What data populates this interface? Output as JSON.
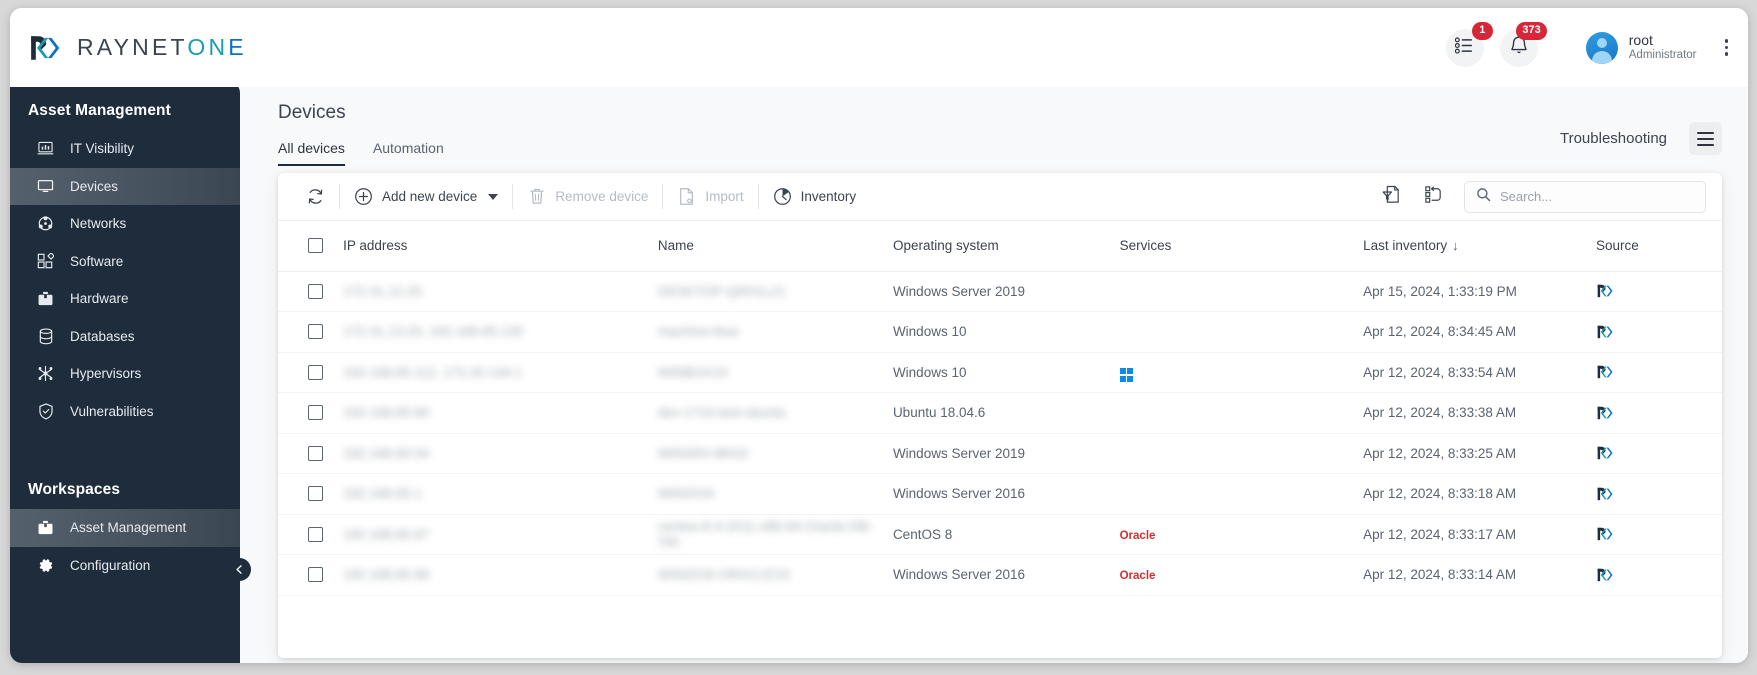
{
  "brand": {
    "name_main": "RAYNET",
    "name_accent_first": "ON",
    "name_accent_second": "E",
    "logo_icon": "raynet-logo-mark",
    "colors": {
      "dark": "#1e2c3c",
      "teal": "#1a9bb0",
      "blue": "#0b72c4"
    }
  },
  "header": {
    "tasks_icon": "task-list-icon",
    "tasks_badge": "1",
    "notifications_icon": "bell-icon",
    "notifications_badge": "373",
    "user_name": "root",
    "user_role": "Administrator",
    "avatar_icon": "user-avatar-icon",
    "overflow_icon": "vertical-dots-icon"
  },
  "sidebar": {
    "section_title": "Asset Management",
    "items": [
      {
        "label": "IT Visibility",
        "icon": "monitor-chart-icon",
        "active": false
      },
      {
        "label": "Devices",
        "icon": "desktop-icon",
        "active": true
      },
      {
        "label": "Networks",
        "icon": "network-nodes-icon",
        "active": false
      },
      {
        "label": "Software",
        "icon": "blocks-icon",
        "active": false
      },
      {
        "label": "Hardware",
        "icon": "toolbox-icon",
        "active": false
      },
      {
        "label": "Databases",
        "icon": "database-icon",
        "active": false
      },
      {
        "label": "Hypervisors",
        "icon": "hypervisor-icon",
        "active": false
      },
      {
        "label": "Vulnerabilities",
        "icon": "shield-check-icon",
        "active": false
      }
    ],
    "workspaces_title": "Workspaces",
    "workspaces": [
      {
        "label": "Asset Management",
        "icon": "briefcase-icon",
        "active": true
      },
      {
        "label": "Configuration",
        "icon": "gear-icon",
        "active": false
      }
    ],
    "collapse_icon": "chevron-left-icon"
  },
  "page": {
    "title": "Devices",
    "tabs": [
      {
        "label": "All devices",
        "active": true
      },
      {
        "label": "Automation",
        "active": false
      }
    ],
    "troubleshooting_label": "Troubleshooting",
    "menu_icon": "hamburger-menu-icon"
  },
  "toolbar": {
    "refresh_icon": "refresh-icon",
    "add_device_label": "Add new device",
    "add_device_icon": "plus-circle-icon",
    "add_device_caret": "chevron-down-icon",
    "remove_device_label": "Remove device",
    "remove_device_icon": "trash-icon",
    "remove_device_disabled": true,
    "import_label": "Import",
    "import_icon": "file-import-icon",
    "import_disabled": true,
    "inventory_label": "Inventory",
    "inventory_icon": "inventory-scan-icon",
    "filter_icon": "filter-document-icon",
    "columns_icon": "column-config-icon",
    "search_icon": "search-icon",
    "search_placeholder": "Search...",
    "search_value": ""
  },
  "table": {
    "columns": [
      "IP address",
      "Name",
      "Operating system",
      "Services",
      "Last inventory",
      "Source"
    ],
    "sorted_column": "Last inventory",
    "sort_direction": "desc",
    "sort_glyph": "↓",
    "select_all_checked": false,
    "rows": [
      {
        "checked": false,
        "ip": "172.31.12.25",
        "name": "DESKTOP-QRA1L21",
        "os": "Windows Server 2019",
        "service_icon": "",
        "service_tag": "",
        "last_inventory": "Apr 15, 2024, 1:33:19 PM",
        "source_icon": "raynet-logo-mark"
      },
      {
        "checked": false,
        "ip": "172.31.13.20, 192.168.65.130",
        "name": "machine-blue",
        "os": "Windows 10",
        "service_icon": "",
        "service_tag": "",
        "last_inventory": "Apr 12, 2024, 8:34:45 AM",
        "source_icon": "raynet-logo-mark"
      },
      {
        "checked": false,
        "ip": "192.168.65.112, 172.20.144.1",
        "name": "WINBOX10",
        "os": "Windows 10",
        "service_icon": "windows-logo-icon",
        "service_tag": "",
        "last_inventory": "Apr 12, 2024, 8:33:54 AM",
        "source_icon": "raynet-logo-mark"
      },
      {
        "checked": false,
        "ip": "192.168.65.80",
        "name": "dev-1710-test-ubuntu",
        "os": "Ubuntu 18.04.6",
        "service_icon": "",
        "service_tag": "",
        "last_inventory": "Apr 12, 2024, 8:33:38 AM",
        "source_icon": "raynet-logo-mark"
      },
      {
        "checked": false,
        "ip": "192.168.65.54",
        "name": "WINSRV-BK02",
        "os": "Windows Server 2019",
        "service_icon": "",
        "service_tag": "",
        "last_inventory": "Apr 12, 2024, 8:33:25 AM",
        "source_icon": "raynet-logo-mark"
      },
      {
        "checked": false,
        "ip": "192.168.65.1",
        "name": "WIN2016",
        "os": "Windows Server 2016",
        "service_icon": "",
        "service_tag": "",
        "last_inventory": "Apr 12, 2024, 8:33:18 AM",
        "source_icon": "raynet-logo-mark"
      },
      {
        "checked": false,
        "ip": "192.168.65.67",
        "name": "centos-8-4-2011-x86-64-Oracle-DB-19c",
        "os": "CentOS 8",
        "service_icon": "",
        "service_tag": "Oracle",
        "last_inventory": "Apr 12, 2024, 8:33:17 AM",
        "source_icon": "raynet-logo-mark"
      },
      {
        "checked": false,
        "ip": "192.168.65.66",
        "name": "WIN2016-ORACLE19",
        "os": "Windows Server 2016",
        "service_icon": "",
        "service_tag": "Oracle",
        "last_inventory": "Apr 12, 2024, 8:33:14 AM",
        "source_icon": "raynet-logo-mark"
      }
    ]
  }
}
